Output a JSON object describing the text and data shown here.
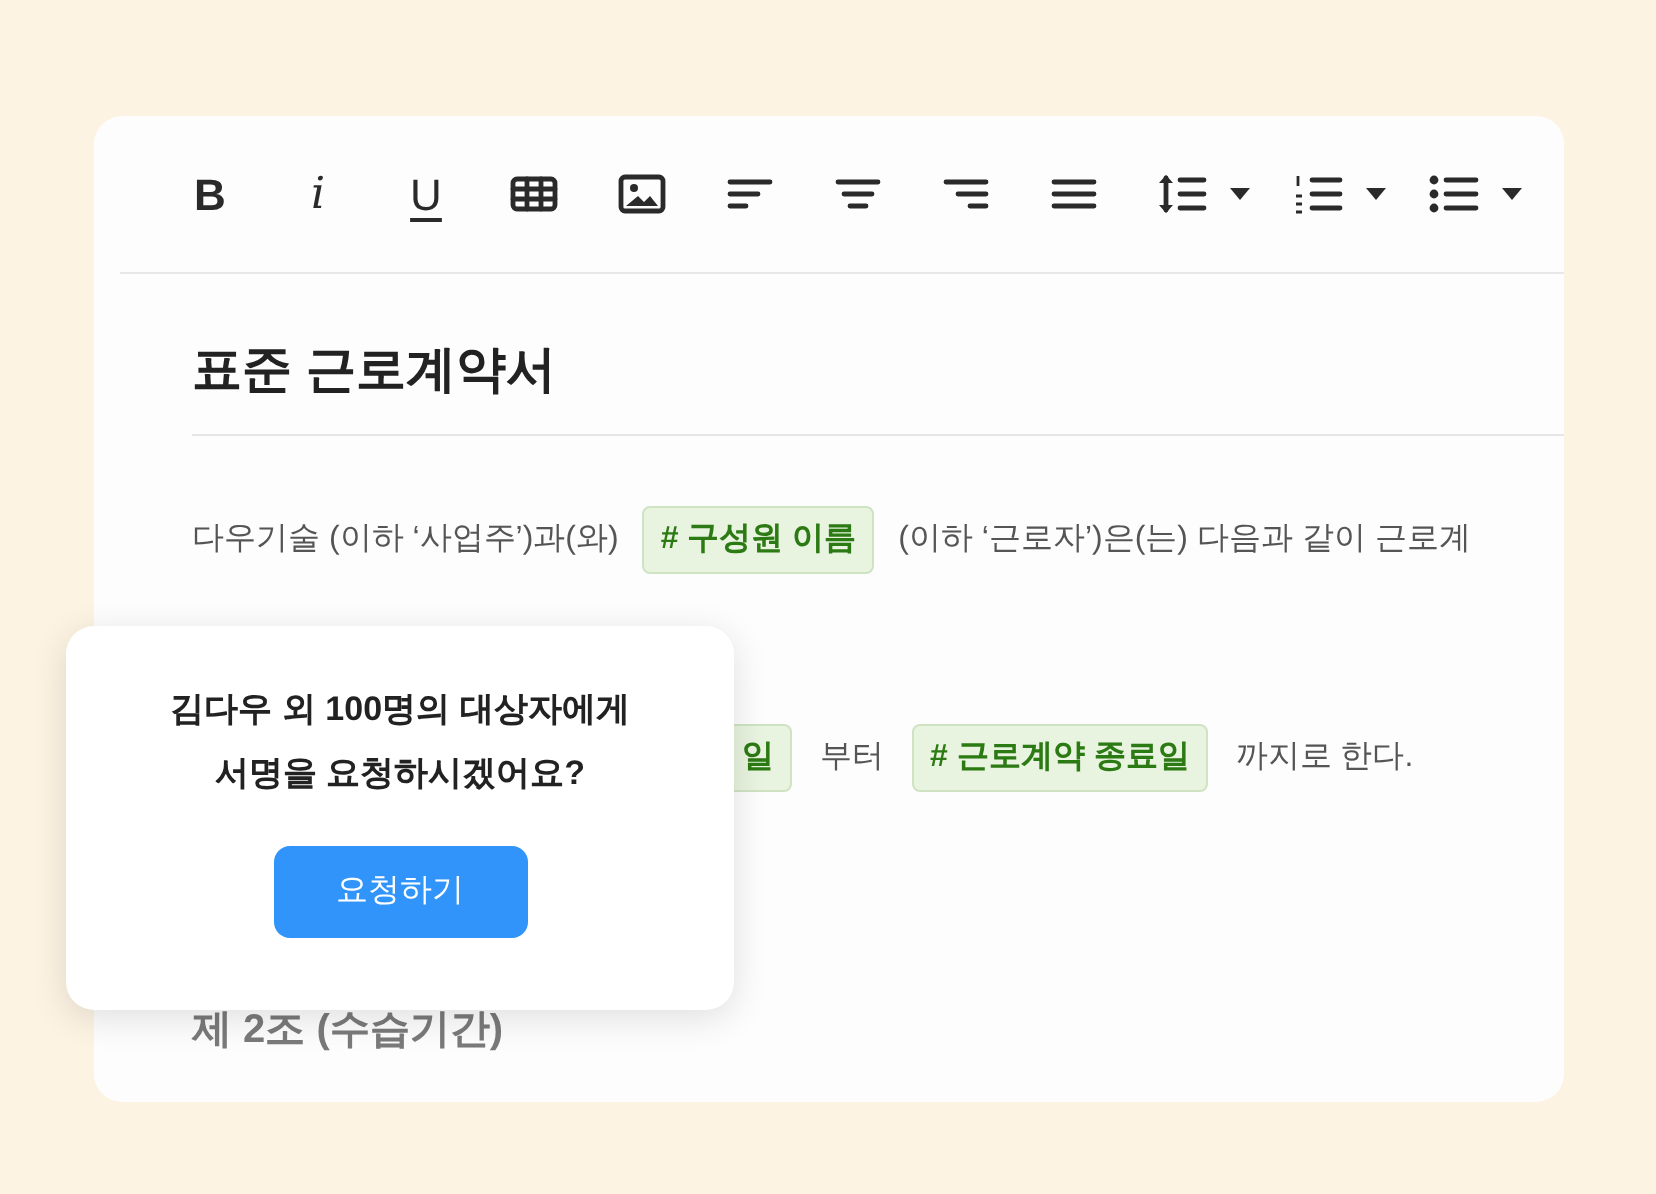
{
  "toolbar": [
    {
      "kind": "text",
      "label": "B"
    },
    {
      "kind": "text",
      "label": "i"
    },
    {
      "kind": "text",
      "label": "U"
    },
    {
      "kind": "icon"
    },
    {
      "kind": "icon"
    },
    {
      "kind": "icon"
    },
    {
      "kind": "icon"
    },
    {
      "kind": "icon"
    },
    {
      "kind": "icon"
    },
    {
      "kind": "icon"
    },
    {
      "kind": "icon"
    },
    {
      "kind": "icon"
    }
  ],
  "document": {
    "title": "표준 근로계약서",
    "lines": [
      [
        {
          "kind": "text",
          "text": "다우기술 (이하 ‘사업주’)과(와)"
        },
        {
          "kind": "tag",
          "text": "# 구성원 이름"
        },
        {
          "kind": "text",
          "text": "(이하 ‘근로자’)은(는) 다음과 같이 근로계"
        }
      ],
      [
        {
          "kind": "tag",
          "text": "일"
        },
        {
          "kind": "text",
          "text": "부터"
        },
        {
          "kind": "tag",
          "text": "# 근로계약 종료일"
        },
        {
          "kind": "text",
          "text": "까지로 한다."
        }
      ]
    ],
    "section_heading": "제 2조 (수습기간)"
  },
  "popup": {
    "message_lines": [
      "김다우 외 100명의 대상자에게",
      "서명을 요청하시겠어요?"
    ],
    "button": "요청하기"
  }
}
